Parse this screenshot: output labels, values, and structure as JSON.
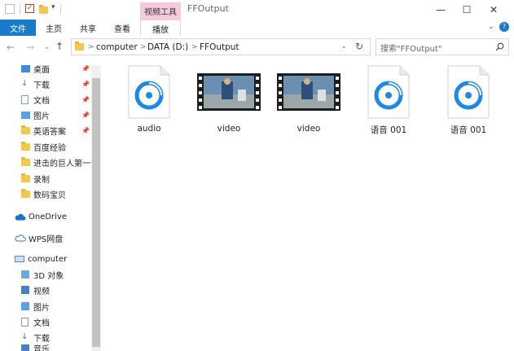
{
  "window": {
    "title": "FFOutput",
    "context_tab": "视频工具",
    "controls": {
      "minimize": "—",
      "maximize": "☐",
      "close": "✕"
    }
  },
  "ribbon": {
    "file": "文件",
    "tabs": [
      "主页",
      "共享",
      "查看",
      "播放"
    ]
  },
  "address": {
    "crumbs": [
      "computer",
      "DATA (D:)",
      "FFOutput"
    ],
    "search_placeholder": "搜索\"FFOutput\""
  },
  "nav": {
    "quick_access": [
      {
        "label": "桌面",
        "pinned": true
      },
      {
        "label": "下载",
        "pinned": true
      },
      {
        "label": "文档",
        "pinned": true
      },
      {
        "label": "图片",
        "pinned": true
      },
      {
        "label": "英语答案",
        "pinned": true
      },
      {
        "label": "百度经验",
        "pinned": false
      },
      {
        "label": "进击的巨人第一部",
        "pinned": false
      },
      {
        "label": "录制",
        "pinned": false
      },
      {
        "label": "数码宝贝",
        "pinned": false
      }
    ],
    "onedrive": "OneDrive",
    "wps": "WPS网盘",
    "computer": "computer",
    "computer_items": [
      "3D 对象",
      "视频",
      "图片",
      "文档",
      "下载",
      "音乐"
    ]
  },
  "files": [
    {
      "name": "audio",
      "kind": "audio"
    },
    {
      "name": "video",
      "kind": "video"
    },
    {
      "name": "video",
      "kind": "video"
    },
    {
      "name": "语音 001",
      "kind": "audio"
    },
    {
      "name": "语音 001",
      "kind": "audio"
    }
  ],
  "colors": {
    "accent": "#1979ca",
    "context_tab": "#f6c9dc",
    "audio_icon": "#1e88e5"
  }
}
